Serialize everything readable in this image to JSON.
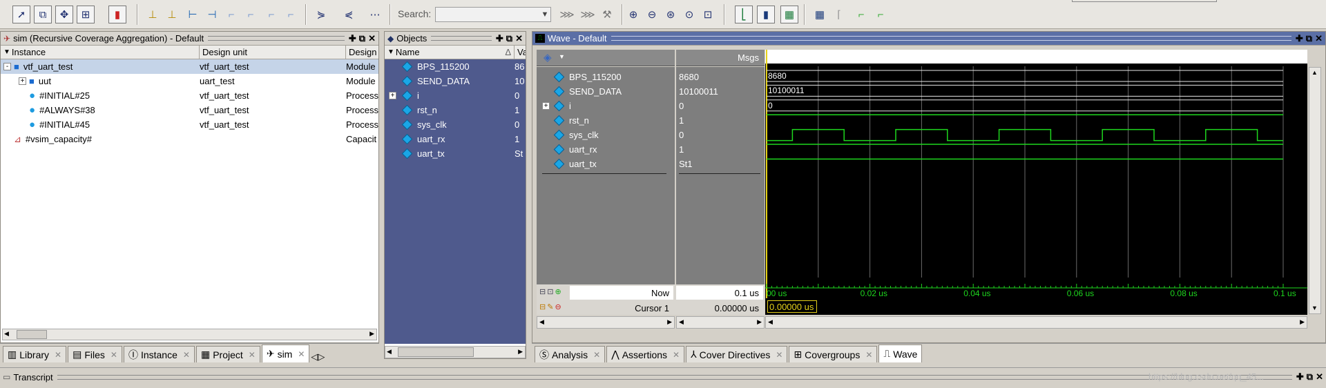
{
  "toolbar": {
    "search_label": "Search:",
    "search_value": "",
    "icons": [
      "select-icon",
      "zoom-box-icon",
      "move-icon",
      "split-icon",
      "stoplight-icon",
      "insert-cursor-icon",
      "delete-cursor-icon",
      "prev-edge-icon",
      "next-edge-icon",
      "falling-edge-icon",
      "rising-edge-icon",
      "expand-icon",
      "collapse-icon",
      "find-icon",
      "zoom-in-icon",
      "zoom-out-icon",
      "zoom-full-icon",
      "zoom-cursor-icon",
      "zoom-area-icon"
    ]
  },
  "sim": {
    "title": "sim (Recursive Coverage Aggregation) - Default",
    "columns": [
      "Instance",
      "Design unit",
      "Design"
    ],
    "rows": [
      {
        "expander": "-",
        "icon": "module-icon",
        "instance": "vtf_uart_test",
        "unit": "vtf_uart_test",
        "design": "Module",
        "indent": 0
      },
      {
        "expander": "+",
        "icon": "module-icon",
        "instance": "uut",
        "unit": "uart_test",
        "design": "Module",
        "indent": 1
      },
      {
        "expander": "",
        "icon": "process-icon",
        "instance": "#INITIAL#25",
        "unit": "vtf_uart_test",
        "design": "Process",
        "indent": 1
      },
      {
        "expander": "",
        "icon": "process-icon",
        "instance": "#ALWAYS#38",
        "unit": "vtf_uart_test",
        "design": "Process",
        "indent": 1
      },
      {
        "expander": "",
        "icon": "process-icon",
        "instance": "#INITIAL#45",
        "unit": "vtf_uart_test",
        "design": "Process",
        "indent": 1
      },
      {
        "expander": "",
        "icon": "capacity-icon",
        "instance": "#vsim_capacity#",
        "unit": "",
        "design": "Capacit",
        "indent": 0
      }
    ],
    "tabs": [
      "Library",
      "Files",
      "Instance",
      "Project",
      "sim"
    ]
  },
  "objects": {
    "title": "Objects",
    "columns": [
      "Name",
      "Va"
    ],
    "sort_mark": "Δ",
    "rows": [
      {
        "name": "BPS_115200",
        "value": "86",
        "expander": ""
      },
      {
        "name": "SEND_DATA",
        "value": "10",
        "expander": ""
      },
      {
        "name": "i",
        "value": "0",
        "expander": "+"
      },
      {
        "name": "rst_n",
        "value": "1",
        "expander": ""
      },
      {
        "name": "sys_clk",
        "value": "0",
        "expander": ""
      },
      {
        "name": "uart_rx",
        "value": "1",
        "expander": ""
      },
      {
        "name": "uart_tx",
        "value": "St",
        "expander": ""
      }
    ]
  },
  "wave": {
    "title": "Wave - Default",
    "msgs_label": "Msgs",
    "signals": [
      {
        "name": "BPS_115200",
        "msg": "8680",
        "wave_text": "8680",
        "kind": "bus",
        "expander": ""
      },
      {
        "name": "SEND_DATA",
        "msg": "10100011",
        "wave_text": "10100011",
        "kind": "bus",
        "expander": ""
      },
      {
        "name": "i",
        "msg": "0",
        "wave_text": "0",
        "kind": "bus",
        "expander": "+"
      },
      {
        "name": "rst_n",
        "msg": "1",
        "wave_text": "",
        "kind": "high",
        "expander": ""
      },
      {
        "name": "sys_clk",
        "msg": "0",
        "wave_text": "",
        "kind": "clock",
        "expander": ""
      },
      {
        "name": "uart_rx",
        "msg": "1",
        "wave_text": "",
        "kind": "high",
        "expander": ""
      },
      {
        "name": "uart_tx",
        "msg": "St1",
        "wave_text": "",
        "kind": "high",
        "expander": ""
      }
    ],
    "now_label": "Now",
    "now_value": "0.1 us",
    "cursor_label": "Cursor 1",
    "cursor_value": "0.00000 us",
    "cursor_box": "0.00000 us",
    "time_ticks": [
      "00 us",
      "0.02 us",
      "0.04 us",
      "0.06 us",
      "0.08 us",
      "0.1 us"
    ],
    "tabs": [
      "Analysis",
      "Assertions",
      "Cover Directives",
      "Covergroups",
      "Wave"
    ]
  },
  "transcript": {
    "title": "Transcript",
    "watermark": "https://blog.csdn.net/qq_45..."
  },
  "colors": {
    "objects_bg": "#4f5a8d",
    "wave_names_bg": "#7e7e7e",
    "wave_canvas_bg": "#000000",
    "signal_green": "#1ed71e",
    "cursor_yellow": "#e6d21a",
    "grid": "#6b6b6b"
  }
}
